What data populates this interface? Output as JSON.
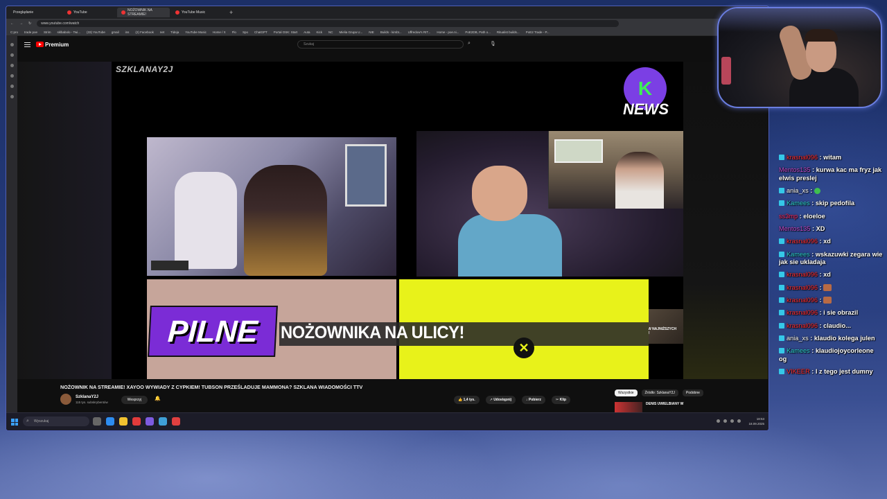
{
  "browser": {
    "tabs": [
      {
        "label": "Przeglądanie"
      },
      {
        "label": "YouTube"
      },
      {
        "label": "NOŻOWNIK NA STREAMIE!"
      },
      {
        "label": "YouTube Music"
      }
    ],
    "new_tab": "+",
    "url": "www.youtube.com/watch",
    "bookmarks": [
      "C:pro",
      "trade poe",
      "Strim",
      "sklbabolo - Twi...",
      "(33) YouTube",
      "gmail",
      "ins",
      "(2) Facebook",
      "net",
      "Tidеja",
      "YouTube Music",
      "Home / X",
      "Flo",
      "Spo",
      "ChatGPT",
      "Portal OSK: Start",
      "Auta",
      "Kick",
      "NC",
      "Mielia Grupa U...",
      "NIE",
      "Builds - kimbt...",
      "Uffredow's RIT...",
      "Home - poe.ni...",
      "PoE2DB, Path o...",
      "Ritualist builds...",
      "PoE2 Trade - P..."
    ]
  },
  "youtube": {
    "logo_label": "Premium",
    "search_placeholder": "Szukaj",
    "player": {
      "channel_watermark": "SZKLANAY2J",
      "news_logo_text": "NEWS",
      "promo_text": "ZDOBĄDŹ GRY I KARTY W NAJNIŻSZYCH CENACH!",
      "breaking_label": "PILNE",
      "ticker": "NOŻOWNIKA NA ULICY!"
    },
    "video_title": "NOŻOWNIK NA STREAMIE! XAYOO WYWIADY Z CYPKIEM! TUBSON PRZEŚLADUJE MAMMONA? SZKLANA WIADOMOŚCI TTV",
    "channel": {
      "name": "SzklanaY2J",
      "subs": "115 tys. subskrybentów"
    },
    "support_label": "Wesprzyj",
    "actions": {
      "likes": "1,4 tys.",
      "share": "Udostępnij",
      "download": "Pobierz",
      "clip": "Klip"
    },
    "chips": [
      "Wszystkie",
      "Źródło: SzklanaY2J",
      "Podobne"
    ],
    "recommended_title": "DENIS UWIELBIANY W"
  },
  "taskbar": {
    "search_placeholder": "Wyszukaj",
    "time": "18:53",
    "date": "18.09.2025"
  },
  "chat": [
    {
      "user": "krasnal096",
      "text": "witam",
      "color": "#ff2b2b",
      "icon": true
    },
    {
      "user": "Mentos135",
      "text": "kurwa kac ma fryz jak elwis preslej",
      "color": "#c04ac8",
      "icon": false
    },
    {
      "user": "ania_xs",
      "text": "",
      "color": "#ffffff",
      "icon": true,
      "emote": "green"
    },
    {
      "user": "Kamees",
      "text": "skip pedofila",
      "color": "#2fd3d0",
      "icon": true
    },
    {
      "user": "ss3mp",
      "text": "eloeloe",
      "color": "#ff2b62",
      "icon": false
    },
    {
      "user": "Mentos135",
      "text": "XD",
      "color": "#c04ac8",
      "icon": false
    },
    {
      "user": "krasnal096",
      "text": "xd",
      "color": "#ff2b2b",
      "icon": true
    },
    {
      "user": "Kamees",
      "text": "wskazuwki zegara wie jak sie ukladaja",
      "color": "#2fd3d0",
      "icon": true
    },
    {
      "user": "krasnal096",
      "text": "xd",
      "color": "#ff2b2b",
      "icon": true
    },
    {
      "user": "krasnal096",
      "text": "",
      "color": "#ff2b2b",
      "icon": true,
      "emote": "face"
    },
    {
      "user": "krasnal096",
      "text": "",
      "color": "#ff2b2b",
      "icon": true,
      "emote": "face"
    },
    {
      "user": "krasnal096",
      "text": "i sie obrazil",
      "color": "#ff2b2b",
      "icon": true
    },
    {
      "user": "krasnal096",
      "text": "claudio...",
      "color": "#ff2b2b",
      "icon": true
    },
    {
      "user": "ania_xs",
      "text": "klaudio kolega julen",
      "color": "#ffffff",
      "icon": true
    },
    {
      "user": "Kamees",
      "text": "klaudiojoycorleone og",
      "color": "#2fd3d0",
      "icon": true
    },
    {
      "user": "VIKEER",
      "text": "I z tego jest dumny",
      "color": "#ff2b2b",
      "icon": true
    }
  ]
}
